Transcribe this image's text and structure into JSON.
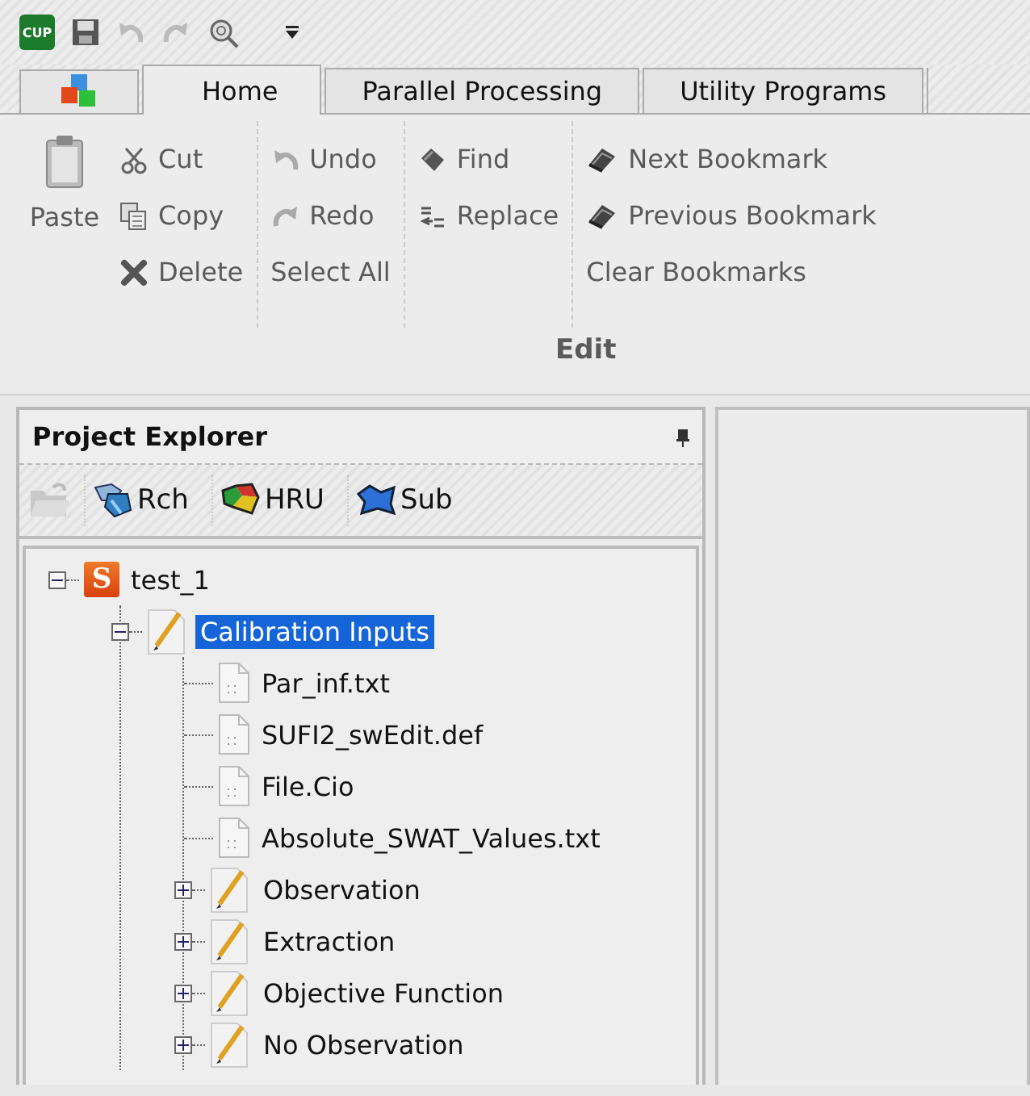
{
  "quick_access": {
    "logo_text": "CUP"
  },
  "tabs": [
    {
      "label": "Home",
      "selected": true
    },
    {
      "label": "Parallel Processing",
      "selected": false
    },
    {
      "label": "Utility Programs",
      "selected": false
    }
  ],
  "ribbon": {
    "group_label": "Edit",
    "paste": {
      "label": "Paste"
    },
    "columns": [
      [
        {
          "label": "Cut",
          "kind": "cut"
        },
        {
          "label": "Copy",
          "kind": "copy"
        },
        {
          "label": "Delete",
          "kind": "delete"
        }
      ],
      [
        {
          "label": "Undo",
          "kind": "undo"
        },
        {
          "label": "Redo",
          "kind": "redo"
        },
        {
          "label": "Select All",
          "kind": "none"
        }
      ],
      [
        {
          "label": "Find",
          "kind": "find"
        },
        {
          "label": "Replace",
          "kind": "replace"
        }
      ],
      [
        {
          "label": "Next Bookmark",
          "kind": "bookmark"
        },
        {
          "label": "Previous Bookmark",
          "kind": "bookmark"
        },
        {
          "label": "Clear Bookmarks",
          "kind": "none"
        }
      ]
    ]
  },
  "explorer": {
    "title": "Project Explorer",
    "tools": [
      {
        "label": "Rch",
        "kind": "rch"
      },
      {
        "label": "HRU",
        "kind": "hru"
      },
      {
        "label": "Sub",
        "kind": "sub"
      }
    ],
    "tree": [
      {
        "label": "test_1",
        "kind": "project",
        "badge": "S",
        "expanded": true,
        "selected": false,
        "children": [
          {
            "label": "Calibration Inputs",
            "kind": "folder",
            "expanded": true,
            "selected": true,
            "children": [
              {
                "label": "Par_inf.txt",
                "kind": "file",
                "selected": false
              },
              {
                "label": "SUFI2_swEdit.def",
                "kind": "file",
                "selected": false
              },
              {
                "label": "File.Cio",
                "kind": "file",
                "selected": false
              },
              {
                "label": "Absolute_SWAT_Values.txt",
                "kind": "file",
                "selected": false
              },
              {
                "label": "Observation",
                "kind": "folder",
                "expanded": false,
                "selected": false
              },
              {
                "label": "Extraction",
                "kind": "folder",
                "expanded": false,
                "selected": false
              },
              {
                "label": "Objective Function",
                "kind": "folder",
                "expanded": false,
                "selected": false
              },
              {
                "label": "No Observation",
                "kind": "folder",
                "expanded": false,
                "selected": false
              }
            ]
          }
        ]
      }
    ]
  }
}
